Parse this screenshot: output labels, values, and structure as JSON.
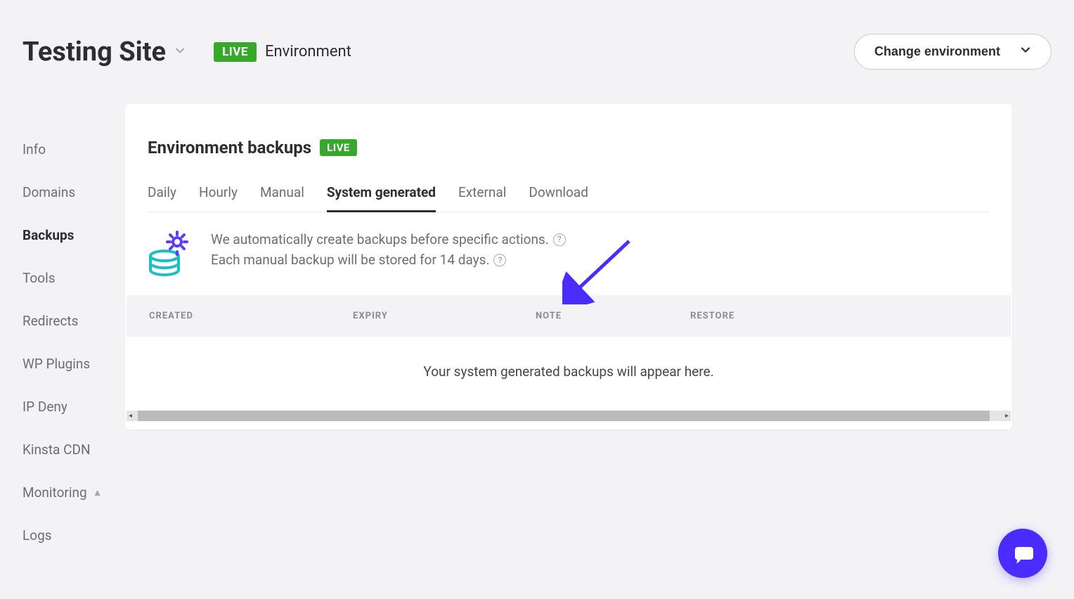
{
  "header": {
    "site_title": "Testing Site",
    "env_badge": "LIVE",
    "env_label": "Environment",
    "change_env_label": "Change environment"
  },
  "sidebar": {
    "items": [
      {
        "label": "Info"
      },
      {
        "label": "Domains"
      },
      {
        "label": "Backups"
      },
      {
        "label": "Tools"
      },
      {
        "label": "Redirects"
      },
      {
        "label": "WP Plugins"
      },
      {
        "label": "IP Deny"
      },
      {
        "label": "Kinsta CDN"
      },
      {
        "label": "Monitoring"
      },
      {
        "label": "Logs"
      }
    ],
    "active_index": 2,
    "monitoring_alert_index": 8
  },
  "card": {
    "title": "Environment backups",
    "badge": "LIVE",
    "tabs": [
      {
        "label": "Daily"
      },
      {
        "label": "Hourly"
      },
      {
        "label": "Manual"
      },
      {
        "label": "System generated"
      },
      {
        "label": "External"
      },
      {
        "label": "Download"
      }
    ],
    "active_tab_index": 3,
    "info_line1": "We automatically create backups before specific actions.",
    "info_line2": "Each manual backup will be stored for 14 days.",
    "columns": {
      "created": "CREATED",
      "expiry": "EXPIRY",
      "note": "NOTE",
      "restore": "RESTORE"
    },
    "empty_message": "Your system generated backups will appear here."
  }
}
